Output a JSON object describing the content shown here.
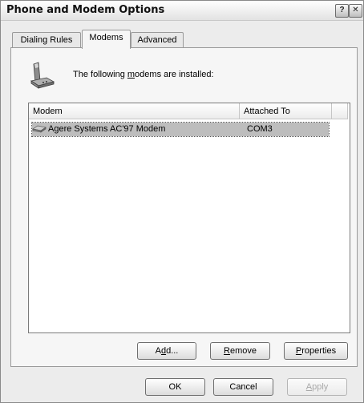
{
  "window": {
    "title": "Phone and Modem Options",
    "help_glyph": "?",
    "close_glyph": "✕"
  },
  "tabs": [
    {
      "label": "Dialing Rules",
      "active": false
    },
    {
      "label": "Modems",
      "active": true
    },
    {
      "label": "Advanced",
      "active": false
    }
  ],
  "panel": {
    "icon": "phone-modem-icon",
    "intro": {
      "pre": "The following ",
      "accel": "m",
      "post": "odems are  installed:"
    },
    "list": {
      "columns": [
        "Modem",
        "Attached To"
      ],
      "rows": [
        {
          "modem": "Agere Systems AC'97 Modem",
          "attached_to": "COM3",
          "selected": true,
          "icon": "modem-device-icon"
        }
      ]
    },
    "buttons": {
      "add": {
        "pre": "A",
        "accel": "d",
        "post": "d..."
      },
      "remove": {
        "pre": "",
        "accel": "R",
        "post": "emove"
      },
      "properties": {
        "pre": "",
        "accel": "P",
        "post": "roperties"
      }
    }
  },
  "dialog_buttons": {
    "ok": "OK",
    "cancel": "Cancel",
    "apply": {
      "pre": "",
      "accel": "A",
      "post": "pply",
      "enabled": false
    }
  }
}
